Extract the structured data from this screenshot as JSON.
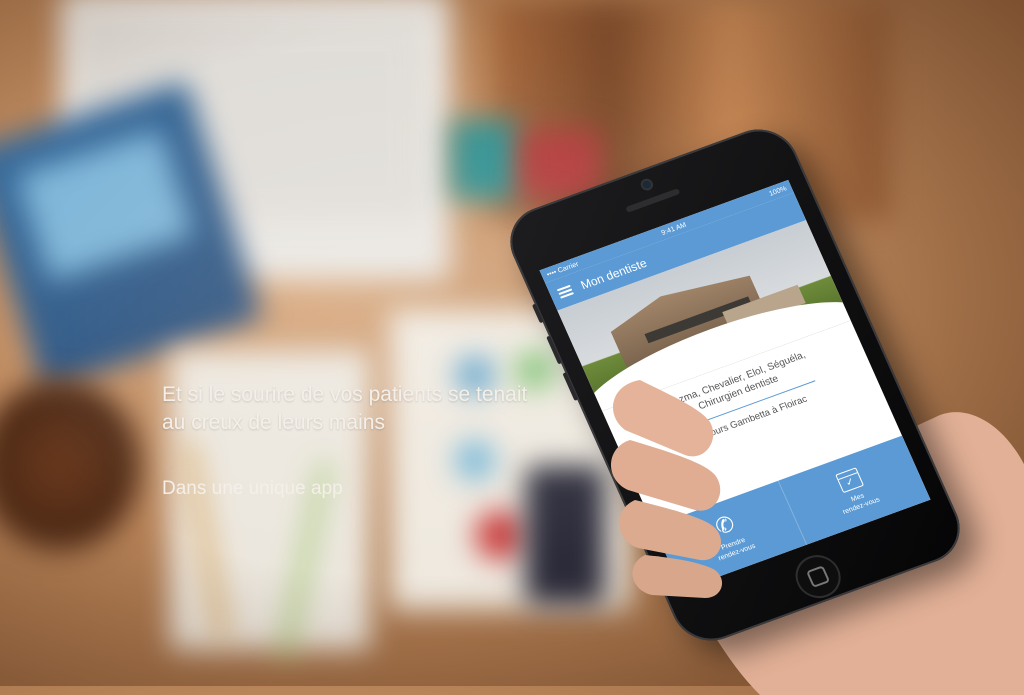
{
  "hero": {
    "headline_line1": "Et si le sourire de vos patients se tenait",
    "headline_line2": "au creux de leurs mains",
    "subline": "Dans une unique app"
  },
  "phone": {
    "status": {
      "carrier": "•••• Carrier",
      "time": "9:41 AM",
      "battery": "100%"
    },
    "navbar": {
      "title": "Mon dentiste",
      "menu_icon": "hamburger-icon"
    },
    "dentist": {
      "names": "Dr Azma, Chevalier, Elol, Séguéla,",
      "specialty": "Chirurgien dentiste",
      "address": "69 cours Gambetta à Floirac"
    },
    "actions": [
      {
        "icon": "phone-icon",
        "label_line1": "Prendre",
        "label_line2": "rendez-vous"
      },
      {
        "icon": "calendar-check-icon",
        "label_line1": "Mes",
        "label_line2": "rendez-vous"
      }
    ]
  },
  "colors": {
    "accent": "#5b9ad4",
    "text": "#f4efe8"
  }
}
